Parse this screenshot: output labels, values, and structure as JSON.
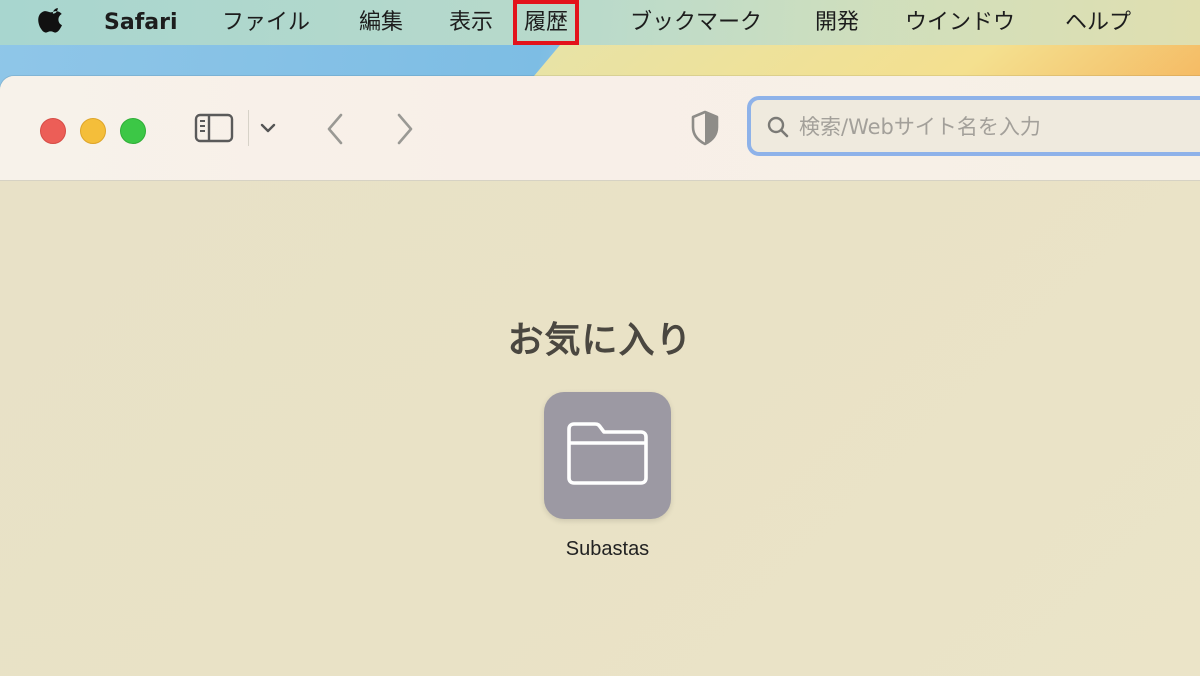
{
  "menubar": {
    "app_name": "Safari",
    "items": [
      "ファイル",
      "編集",
      "表示",
      "履歴",
      "ブックマーク",
      "開発",
      "ウインドウ",
      "ヘルプ"
    ],
    "highlighted_item": "履歴",
    "highlight_color": "#e3121b"
  },
  "toolbar": {
    "search_placeholder": "検索/Webサイト名を入力",
    "icons": [
      "sidebar-icon",
      "chevron-down-icon",
      "back-icon",
      "forward-icon",
      "privacy-shield-icon",
      "search-icon"
    ]
  },
  "content": {
    "favorites_title": "お気に入り",
    "favorites": [
      {
        "label": "Subastas",
        "icon": "folder-icon"
      }
    ]
  },
  "colors": {
    "traffic_close": "#ec5e57",
    "traffic_minimize": "#f4be3a",
    "traffic_maximize": "#3cc746",
    "address_focus_ring": "#8eb2e9",
    "folder_tile": "#9c99a3"
  }
}
